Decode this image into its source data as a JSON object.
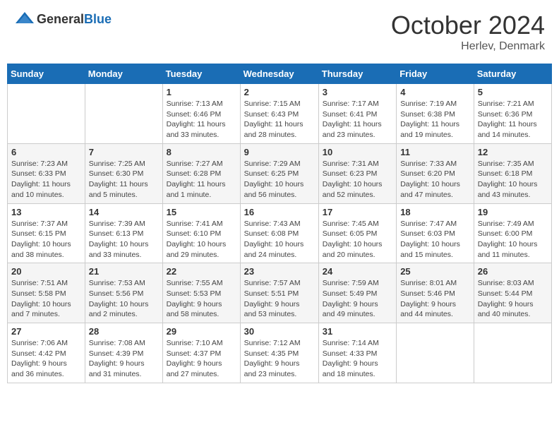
{
  "header": {
    "logo_general": "General",
    "logo_blue": "Blue",
    "month": "October 2024",
    "location": "Herlev, Denmark"
  },
  "weekdays": [
    "Sunday",
    "Monday",
    "Tuesday",
    "Wednesday",
    "Thursday",
    "Friday",
    "Saturday"
  ],
  "weeks": [
    [
      {
        "day": "",
        "info": ""
      },
      {
        "day": "",
        "info": ""
      },
      {
        "day": "1",
        "info": "Sunrise: 7:13 AM\nSunset: 6:46 PM\nDaylight: 11 hours\nand 33 minutes."
      },
      {
        "day": "2",
        "info": "Sunrise: 7:15 AM\nSunset: 6:43 PM\nDaylight: 11 hours\nand 28 minutes."
      },
      {
        "day": "3",
        "info": "Sunrise: 7:17 AM\nSunset: 6:41 PM\nDaylight: 11 hours\nand 23 minutes."
      },
      {
        "day": "4",
        "info": "Sunrise: 7:19 AM\nSunset: 6:38 PM\nDaylight: 11 hours\nand 19 minutes."
      },
      {
        "day": "5",
        "info": "Sunrise: 7:21 AM\nSunset: 6:36 PM\nDaylight: 11 hours\nand 14 minutes."
      }
    ],
    [
      {
        "day": "6",
        "info": "Sunrise: 7:23 AM\nSunset: 6:33 PM\nDaylight: 11 hours\nand 10 minutes."
      },
      {
        "day": "7",
        "info": "Sunrise: 7:25 AM\nSunset: 6:30 PM\nDaylight: 11 hours\nand 5 minutes."
      },
      {
        "day": "8",
        "info": "Sunrise: 7:27 AM\nSunset: 6:28 PM\nDaylight: 11 hours\nand 1 minute."
      },
      {
        "day": "9",
        "info": "Sunrise: 7:29 AM\nSunset: 6:25 PM\nDaylight: 10 hours\nand 56 minutes."
      },
      {
        "day": "10",
        "info": "Sunrise: 7:31 AM\nSunset: 6:23 PM\nDaylight: 10 hours\nand 52 minutes."
      },
      {
        "day": "11",
        "info": "Sunrise: 7:33 AM\nSunset: 6:20 PM\nDaylight: 10 hours\nand 47 minutes."
      },
      {
        "day": "12",
        "info": "Sunrise: 7:35 AM\nSunset: 6:18 PM\nDaylight: 10 hours\nand 43 minutes."
      }
    ],
    [
      {
        "day": "13",
        "info": "Sunrise: 7:37 AM\nSunset: 6:15 PM\nDaylight: 10 hours\nand 38 minutes."
      },
      {
        "day": "14",
        "info": "Sunrise: 7:39 AM\nSunset: 6:13 PM\nDaylight: 10 hours\nand 33 minutes."
      },
      {
        "day": "15",
        "info": "Sunrise: 7:41 AM\nSunset: 6:10 PM\nDaylight: 10 hours\nand 29 minutes."
      },
      {
        "day": "16",
        "info": "Sunrise: 7:43 AM\nSunset: 6:08 PM\nDaylight: 10 hours\nand 24 minutes."
      },
      {
        "day": "17",
        "info": "Sunrise: 7:45 AM\nSunset: 6:05 PM\nDaylight: 10 hours\nand 20 minutes."
      },
      {
        "day": "18",
        "info": "Sunrise: 7:47 AM\nSunset: 6:03 PM\nDaylight: 10 hours\nand 15 minutes."
      },
      {
        "day": "19",
        "info": "Sunrise: 7:49 AM\nSunset: 6:00 PM\nDaylight: 10 hours\nand 11 minutes."
      }
    ],
    [
      {
        "day": "20",
        "info": "Sunrise: 7:51 AM\nSunset: 5:58 PM\nDaylight: 10 hours\nand 7 minutes."
      },
      {
        "day": "21",
        "info": "Sunrise: 7:53 AM\nSunset: 5:56 PM\nDaylight: 10 hours\nand 2 minutes."
      },
      {
        "day": "22",
        "info": "Sunrise: 7:55 AM\nSunset: 5:53 PM\nDaylight: 9 hours\nand 58 minutes."
      },
      {
        "day": "23",
        "info": "Sunrise: 7:57 AM\nSunset: 5:51 PM\nDaylight: 9 hours\nand 53 minutes."
      },
      {
        "day": "24",
        "info": "Sunrise: 7:59 AM\nSunset: 5:49 PM\nDaylight: 9 hours\nand 49 minutes."
      },
      {
        "day": "25",
        "info": "Sunrise: 8:01 AM\nSunset: 5:46 PM\nDaylight: 9 hours\nand 44 minutes."
      },
      {
        "day": "26",
        "info": "Sunrise: 8:03 AM\nSunset: 5:44 PM\nDaylight: 9 hours\nand 40 minutes."
      }
    ],
    [
      {
        "day": "27",
        "info": "Sunrise: 7:06 AM\nSunset: 4:42 PM\nDaylight: 9 hours\nand 36 minutes."
      },
      {
        "day": "28",
        "info": "Sunrise: 7:08 AM\nSunset: 4:39 PM\nDaylight: 9 hours\nand 31 minutes."
      },
      {
        "day": "29",
        "info": "Sunrise: 7:10 AM\nSunset: 4:37 PM\nDaylight: 9 hours\nand 27 minutes."
      },
      {
        "day": "30",
        "info": "Sunrise: 7:12 AM\nSunset: 4:35 PM\nDaylight: 9 hours\nand 23 minutes."
      },
      {
        "day": "31",
        "info": "Sunrise: 7:14 AM\nSunset: 4:33 PM\nDaylight: 9 hours\nand 18 minutes."
      },
      {
        "day": "",
        "info": ""
      },
      {
        "day": "",
        "info": ""
      }
    ]
  ]
}
